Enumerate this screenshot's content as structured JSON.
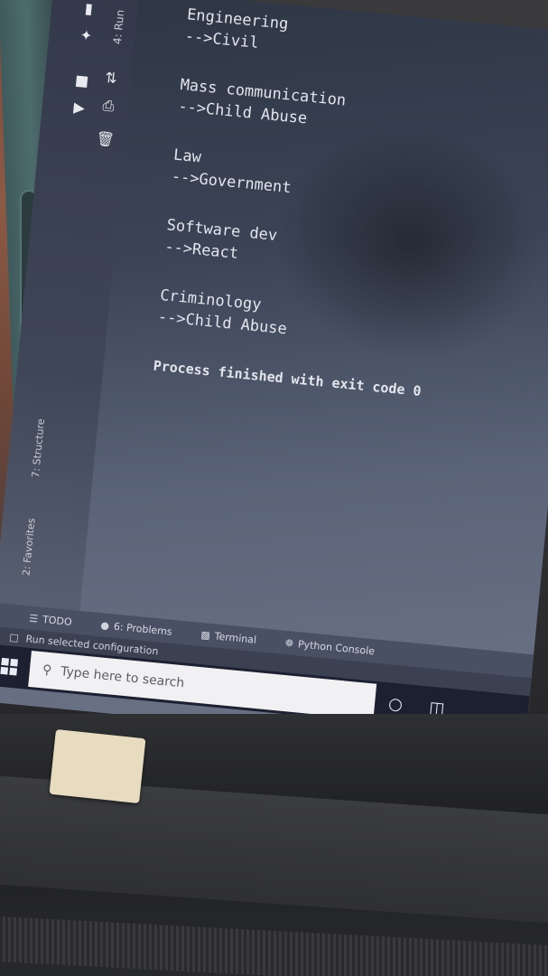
{
  "colors": {
    "console_text": "#e3e5ec",
    "taskbar": "#1d2030",
    "search_box": "#f1f1f3"
  },
  "tool_window": {
    "run_tab": "4: Run",
    "favorites_tab": "2: Favorites",
    "structure_tab": "7: Structure",
    "icons": [
      "rerun-icon",
      "stop-icon",
      "pin-icon",
      "print-icon",
      "sort-icon",
      "delete-icon",
      "play-icon"
    ]
  },
  "console": {
    "lines": [
      {
        "heading": "Engineering",
        "sub": "-->Civil"
      },
      {
        "heading": "Mass communication",
        "sub": "-->Child Abuse"
      },
      {
        "heading": "Law",
        "sub": "-->Government"
      },
      {
        "heading": "Software dev",
        "sub": "-->React"
      },
      {
        "heading": "Criminology",
        "sub": "-->Child Abuse"
      }
    ],
    "finish": "Process finished with exit code 0"
  },
  "bottom_tabs": {
    "todo": "TODO",
    "problems": "6: Problems",
    "terminal": "Terminal",
    "python_console": "Python Console"
  },
  "status_bar": {
    "text": "Run selected configuration"
  },
  "taskbar": {
    "search_placeholder": "Type here to search",
    "icons": [
      "windows-logo-icon",
      "search-icon",
      "cortana-icon",
      "task-view-icon"
    ]
  }
}
